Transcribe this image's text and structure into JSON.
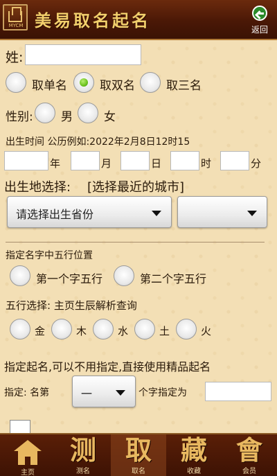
{
  "header": {
    "logo_text": "MYCM",
    "title": "美易取名起名",
    "back_label": "返回"
  },
  "form": {
    "surname_label": "姓:",
    "surname_value": "",
    "name_type": {
      "options": [
        "取单名",
        "取双名",
        "取三名"
      ],
      "selected": "取双名"
    },
    "gender": {
      "label": "性别:",
      "options": [
        "男",
        "女"
      ]
    },
    "birth_hint": "出生时间 公历例如:2022年2月8日12时15",
    "birth_units": [
      "年",
      "月",
      "日",
      "时",
      "分"
    ],
    "birthplace_label": "出生地选择:",
    "birthplace_hint": "[选择最近的城市]",
    "province_select": "请选择出生省份",
    "city_select": "",
    "wuxing_position_label": "指定名字中五行位置",
    "wuxing_position_options": [
      "第一个字五行",
      "第二个字五行"
    ],
    "wuxing_select_label": "五行选择: 主页生辰解析查询",
    "wuxing_options": [
      "金",
      "木",
      "水",
      "土",
      "火"
    ],
    "specify_note": "指定起名,可以不用指定,直接使用精品起名",
    "specify_label": "指定: 名第",
    "specify_select_value": "一",
    "specify_suffix": "个字指定为",
    "specify_value": ""
  },
  "footer": {
    "tabs": [
      {
        "glyph": "",
        "label": "主页"
      },
      {
        "glyph": "测",
        "label": "测名"
      },
      {
        "glyph": "取",
        "label": "取名"
      },
      {
        "glyph": "藏",
        "label": "收藏"
      },
      {
        "glyph": "會",
        "label": "会员"
      }
    ],
    "active": "取名"
  },
  "colors": {
    "header_bg": "#4a1806",
    "title": "#f2cf6c",
    "page_bg": "#f3dfb5",
    "radio_on": "#6cc21e",
    "back_button": "#2a8a2a"
  }
}
